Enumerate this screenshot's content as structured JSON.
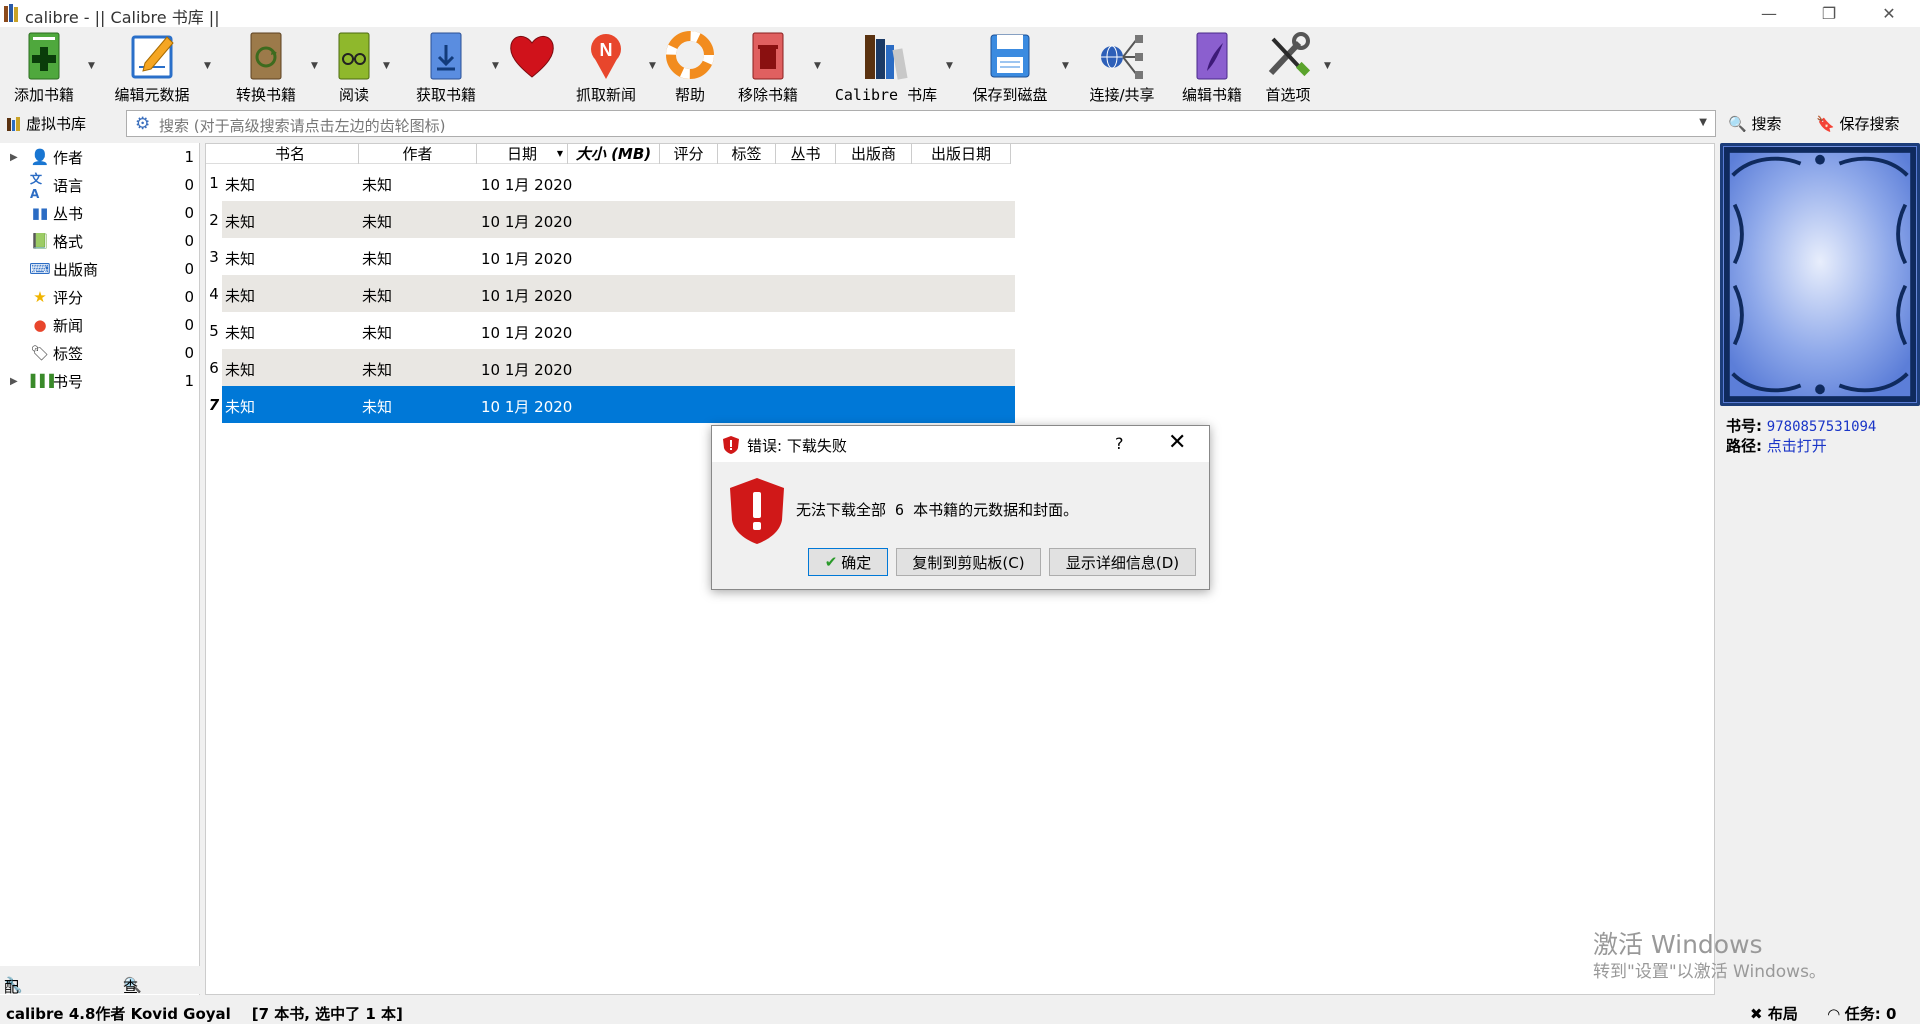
{
  "window": {
    "title": "calibre - || Calibre 书库 ||"
  },
  "toolbar": {
    "add_books": "添加书籍",
    "edit_metadata": "编辑元数据",
    "convert_books": "转换书籍",
    "view": "阅读",
    "get_books": "获取书籍",
    "fetch_news": "抓取新闻",
    "help": "帮助",
    "remove_books": "移除书籍",
    "calibre_library": "Calibre 书库",
    "save_to_disk": "保存到磁盘",
    "connect_share": "连接/共享",
    "edit_book": "编辑书籍",
    "preferences": "首选项"
  },
  "search": {
    "virtual_library": "虚拟书库",
    "placeholder": "搜索 (对于高级搜索请点击左边的齿轮图标)",
    "search_button": "搜索",
    "save_search_button": "保存搜索"
  },
  "tag_browser": {
    "items": [
      {
        "label": "作者",
        "count": "1",
        "icon": "person-icon",
        "expandable": true
      },
      {
        "label": "语言",
        "count": "0",
        "icon": "language-icon",
        "expandable": false
      },
      {
        "label": "丛书",
        "count": "0",
        "icon": "series-icon",
        "expandable": false
      },
      {
        "label": "格式",
        "count": "0",
        "icon": "format-icon",
        "expandable": false
      },
      {
        "label": "出版商",
        "count": "0",
        "icon": "publisher-icon",
        "expandable": false
      },
      {
        "label": "评分",
        "count": "0",
        "icon": "star-icon",
        "expandable": false
      },
      {
        "label": "新闻",
        "count": "0",
        "icon": "news-icon",
        "expandable": false
      },
      {
        "label": "标签",
        "count": "0",
        "icon": "tag-icon",
        "expandable": false
      },
      {
        "label": "书号",
        "count": "1",
        "icon": "barcode-icon",
        "expandable": true
      }
    ],
    "configure": "配置",
    "find": "查找"
  },
  "table": {
    "columns": [
      "书名",
      "作者",
      "日期",
      "大小 (MB)",
      "评分",
      "标签",
      "丛书",
      "出版商",
      "出版日期"
    ],
    "rows": [
      {
        "num": "1",
        "title": "未知",
        "author": "未知",
        "date": "10 1月 2020"
      },
      {
        "num": "2",
        "title": "未知",
        "author": "未知",
        "date": "10 1月 2020"
      },
      {
        "num": "3",
        "title": "未知",
        "author": "未知",
        "date": "10 1月 2020"
      },
      {
        "num": "4",
        "title": "未知",
        "author": "未知",
        "date": "10 1月 2020"
      },
      {
        "num": "5",
        "title": "未知",
        "author": "未知",
        "date": "10 1月 2020"
      },
      {
        "num": "6",
        "title": "未知",
        "author": "未知",
        "date": "10 1月 2020"
      },
      {
        "num": "7",
        "title": "未知",
        "author": "未知",
        "date": "10 1月 2020"
      }
    ],
    "selected_row": 7
  },
  "book_details": {
    "isbn_label": "书号:",
    "isbn_value": "9780857531094",
    "path_label": "路径:",
    "path_value": "点击打开"
  },
  "dialog": {
    "title": "错误: 下载失败",
    "help": "?",
    "close": "✕",
    "message": "无法下载全部 6 本书籍的元数据和封面。",
    "ok_button": "确定",
    "copy_button": "复制到剪贴板(C)",
    "details_button": "显示详细信息(D)"
  },
  "watermark": {
    "line1": "激活 Windows",
    "line2": "转到\"设置\"以激活 Windows。"
  },
  "status": {
    "left": "calibre 4.8作者 Kovid Goyal    [7 本书, 选中了 1 本]",
    "layout": "布局",
    "jobs": "任务: 0"
  },
  "colors": {
    "selection": "#0078d7",
    "alt_row": "#e9e7e3",
    "link": "#1a35c7"
  }
}
